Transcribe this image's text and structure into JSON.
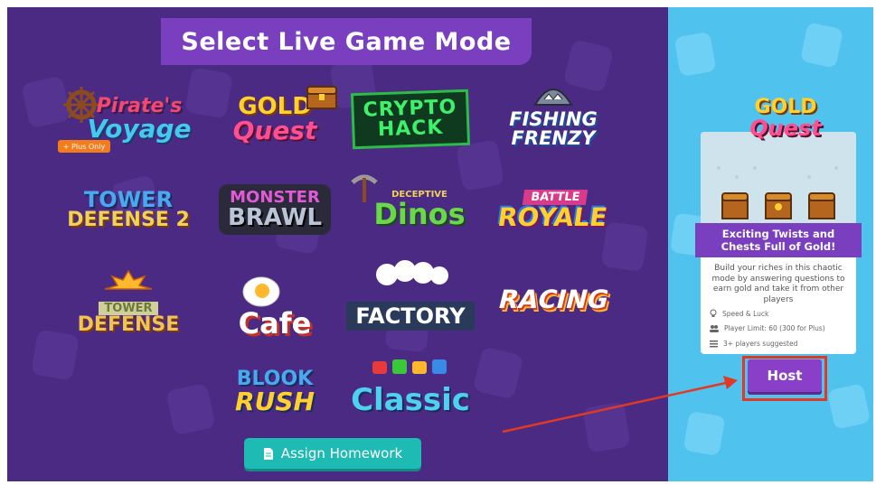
{
  "page_title": "Select Live Game Mode",
  "plus_badge": "+ Plus Only",
  "game_modes": [
    {
      "line1": "Pirate's",
      "line2": "Voyage"
    },
    {
      "line1": "GOLD",
      "line2": "Quest"
    },
    {
      "line1": "CRYPTO",
      "line2": "HACK"
    },
    {
      "line1": "FISHING",
      "line2": "FRENZY"
    },
    {
      "line1": "TOWER",
      "line2": "DEFENSE 2"
    },
    {
      "line1": "MONSTER",
      "line2": "BRAWL"
    },
    {
      "line1": "DECEPTIVE",
      "line2": "Dinos"
    },
    {
      "line1": "BATTLE",
      "line2": "ROYALE"
    },
    {
      "line1": "TOWER",
      "line2": "DEFENSE"
    },
    {
      "line1": "",
      "line2": "Cafe"
    },
    {
      "line1": "",
      "line2": "FACTORY"
    },
    {
      "line1": "",
      "line2": "RACING"
    },
    {
      "line1": "BLOOK",
      "line2": "RUSH"
    },
    {
      "line1": "",
      "line2": "Classic"
    }
  ],
  "assign_homework": "Assign Homework",
  "detail": {
    "logo_line1": "GOLD",
    "logo_line2": "Quest",
    "banner_line1": "Exciting Twists and",
    "banner_line2": "Chests Full of Gold!",
    "description": "Build your riches in this chaotic mode by answering questions to earn gold and take it from other players",
    "stats": [
      "Speed & Luck",
      "Player Limit: 60 (300 for Plus)",
      "3+ players suggested"
    ],
    "host": "Host"
  },
  "colors": {
    "panel": "#4b2a84",
    "title_bar": "#7a3fbf",
    "right_bg": "#4fc2ee",
    "teal": "#1ebbb5",
    "host": "#8a3fc9",
    "annotation_red": "#e03a24",
    "plus_orange": "#f27d1a"
  },
  "icons": [
    "document-icon",
    "lightbulb-icon",
    "people-icon",
    "list-icon",
    "arrow-annotation"
  ]
}
